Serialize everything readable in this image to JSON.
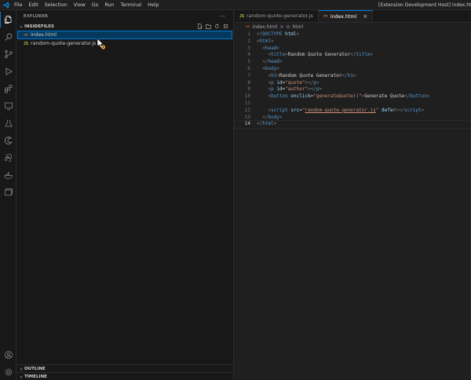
{
  "titlebar": {
    "menu": [
      "File",
      "Edit",
      "Selection",
      "View",
      "Go",
      "Run",
      "Terminal",
      "Help"
    ],
    "window_title": "[Extension Development Host] index.html - insid"
  },
  "activitybar": {
    "items": [
      {
        "icon": "files-icon",
        "active": true
      },
      {
        "icon": "search-icon",
        "active": false
      },
      {
        "icon": "source-control-icon",
        "active": false
      },
      {
        "icon": "run-debug-icon",
        "active": false
      },
      {
        "icon": "extensions-icon",
        "active": false
      },
      {
        "icon": "remote-explorer-icon",
        "active": false
      },
      {
        "icon": "testing-icon",
        "active": false
      },
      {
        "icon": "edge-devtools-icon",
        "active": false
      },
      {
        "icon": "python-icon",
        "active": false
      },
      {
        "icon": "docker-icon",
        "active": false
      },
      {
        "icon": "database-icon",
        "active": false
      }
    ],
    "bottom": [
      {
        "icon": "account-icon"
      },
      {
        "icon": "settings-gear-icon"
      }
    ]
  },
  "sidebar": {
    "header": "EXPLORER",
    "more": "···",
    "folder": "INSIDEFILES",
    "files": [
      {
        "icon": "<>",
        "name": "index.html",
        "selected": true
      },
      {
        "icon": "JS",
        "name": "random-quote-generator.js",
        "selected": false
      }
    ],
    "outline": "OUTLINE",
    "timeline": "TIMELINE"
  },
  "editor": {
    "tabs": [
      {
        "icon": "JS",
        "label": "random-quote-generator.js",
        "active": false
      },
      {
        "icon": "<>",
        "label": "index.html",
        "active": true,
        "close": "×"
      }
    ],
    "breadcrumb": [
      "index.html",
      ">",
      "html"
    ],
    "current_line": 14
  },
  "colors": {
    "accent": "#0078d4",
    "tag": "#569cd6",
    "attr": "#9cdcfe",
    "string": "#ce9178",
    "html_icon": "#e37933",
    "js_icon": "#cbcb41"
  }
}
